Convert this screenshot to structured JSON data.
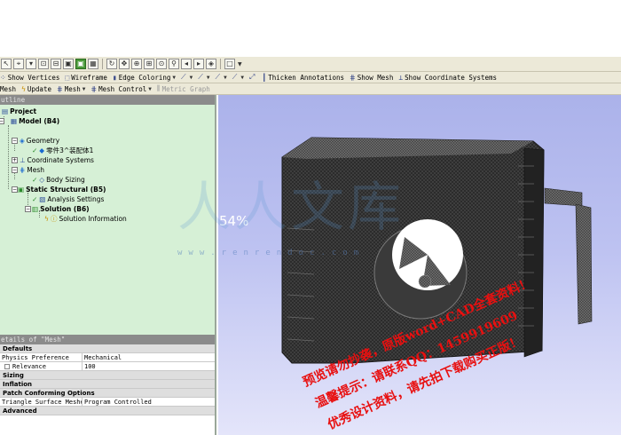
{
  "toolbar_main": {
    "show_vertices": "Show Vertices",
    "wireframe": "Wireframe",
    "edge_coloring": "Edge Coloring",
    "thicken_annotations": "Thicken Annotations",
    "show_mesh": "Show Mesh",
    "show_coordinate_systems": "Show Coordinate Systems"
  },
  "toolbar_mesh": {
    "mesh": "Mesh",
    "update": "Update",
    "mesh_menu": "Mesh",
    "mesh_control": "Mesh Control",
    "metric_graph": "Metric Graph"
  },
  "outline": {
    "title": "utline",
    "nodes": {
      "project": "Project",
      "model": "Model (B4)",
      "geometry": "Geometry",
      "part": "零件3^装配体1",
      "coordinate_systems": "Coordinate Systems",
      "mesh": "Mesh",
      "body_sizing": "Body Sizing",
      "static_structural": "Static Structural (B5)",
      "analysis_settings": "Analysis Settings",
      "solution": "Solution (B6)",
      "solution_information": "Solution Information"
    }
  },
  "details": {
    "title": "etails of \"Mesh\"",
    "defaults": "Defaults",
    "physics_preference_key": "Physics Preference",
    "physics_preference_value": "Mechanical",
    "relevance_key": "Relevance",
    "relevance_value": "100",
    "sizing": "Sizing",
    "inflation": "Inflation",
    "patch_conforming": "Patch Conforming Options",
    "triangle_mesher_key": "Triangle Surface Mesher",
    "triangle_mesher_value": "Program Controlled",
    "advanced": "Advanced"
  },
  "viewport": {
    "progress_text": "54%",
    "progress": 54
  },
  "watermark": {
    "site_cn": "人人文库",
    "site_url": "www.renrendoc.com",
    "line1": "预览请勿抄袭，原版word+CAD全套资料！",
    "line2": "温馨提示：请联系QQ：1459919609",
    "line3": "优秀设计资料，请先拍下载购买正版！"
  },
  "colors": {
    "toolbar_bg": "#ece9d8",
    "outline_bg": "#d6f0d6",
    "pane_header": "#8b8b8b",
    "viewport_top": "#abb2ea",
    "viewport_bottom": "#e4e5fa",
    "model_body": "#2b2b2b",
    "watermark_red": "#e81010"
  }
}
